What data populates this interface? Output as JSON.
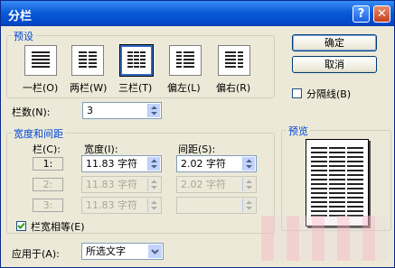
{
  "window": {
    "title": "分栏",
    "help_label": "?",
    "close_label": "✕"
  },
  "presets": {
    "group_label": "预设",
    "items": [
      {
        "label": "一栏(O)",
        "icon": "one-column-icon",
        "selected": false
      },
      {
        "label": "两栏(W)",
        "icon": "two-columns-icon",
        "selected": false
      },
      {
        "label": "三栏(T)",
        "icon": "three-columns-icon",
        "selected": true
      },
      {
        "label": "偏左(L)",
        "icon": "left-columns-icon",
        "selected": false
      },
      {
        "label": "偏右(R)",
        "icon": "right-columns-icon",
        "selected": false
      }
    ]
  },
  "buttons": {
    "ok": "确定",
    "cancel": "取消"
  },
  "separator": {
    "label": "分隔线(B)",
    "checked": false
  },
  "num_columns": {
    "label": "栏数(N):",
    "value": "3"
  },
  "width_spacing": {
    "group_label": "宽度和间距",
    "col_header": "栏(C):",
    "width_header": "宽度(I):",
    "spacing_header": "间距(S):",
    "rows": [
      {
        "num": "1:",
        "width": "11.83 字符",
        "spacing": "2.02 字符",
        "enabled": true
      },
      {
        "num": "2:",
        "width": "11.83 字符",
        "spacing": "2.02 字符",
        "enabled": false
      },
      {
        "num": "3:",
        "width": "11.83 字符",
        "spacing": "",
        "enabled": false
      }
    ]
  },
  "equal_width": {
    "label": "栏宽相等(E)",
    "checked": true
  },
  "apply_to": {
    "label": "应用于(A):",
    "value": "所选文字"
  },
  "preview": {
    "group_label": "预览"
  }
}
